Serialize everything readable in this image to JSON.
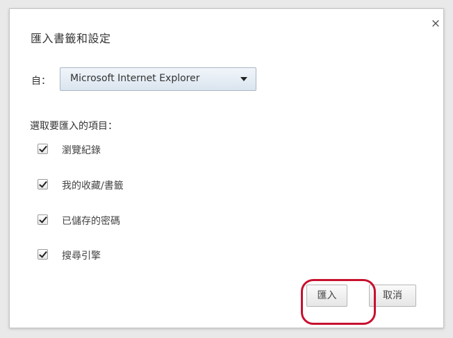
{
  "dialog": {
    "title": "匯入書籤和設定",
    "close_symbol": "×"
  },
  "source": {
    "label": "自：",
    "selected": "Microsoft Internet Explorer"
  },
  "items_heading": "選取要匯入的項目：",
  "items": [
    {
      "label": "瀏覽紀錄",
      "checked": true
    },
    {
      "label": "我的收藏/書籤",
      "checked": true
    },
    {
      "label": "已儲存的密碼",
      "checked": true
    },
    {
      "label": "搜尋引擎",
      "checked": true
    }
  ],
  "buttons": {
    "import_label": "匯入",
    "cancel_label": "取消"
  },
  "colors": {
    "highlight": "#c8102e"
  }
}
